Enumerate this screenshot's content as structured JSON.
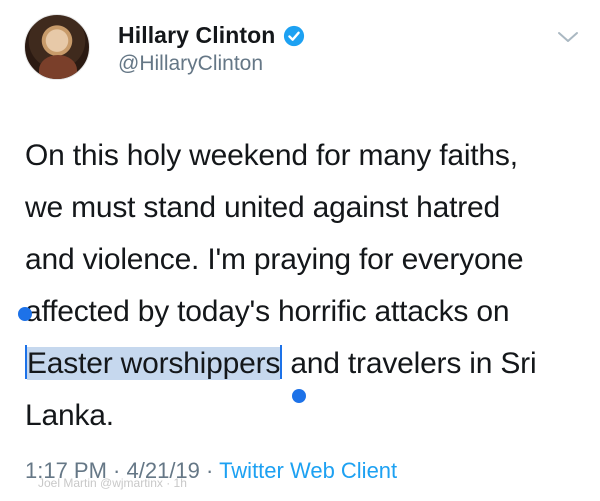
{
  "tweet": {
    "author": {
      "display_name": "Hillary Clinton",
      "handle": "@HillaryClinton",
      "verified": true
    },
    "text": {
      "line1": "On this holy weekend for many faiths,",
      "line2": "we must stand united against hatred",
      "line3": "and violence. I'm praying for everyone",
      "line4": "affected by today's horrific attacks on",
      "line5_selected": "Easter worshippers",
      "line5_rest": " and travelers in Sri",
      "line6": "Lanka."
    },
    "meta": {
      "time": "1:17 PM",
      "date": "4/21/19",
      "separator": " · ",
      "source": "Twitter Web Client"
    },
    "watermark": "Joel Martin @wjmartinx · 1h"
  },
  "colors": {
    "link": "#1da1f2",
    "secondary_text": "#657786",
    "selection": "#c6d8ee",
    "selection_handle": "#1d72e8"
  },
  "icons": {
    "verified": "verified-badge-icon",
    "caret": "chevron-down-icon"
  }
}
